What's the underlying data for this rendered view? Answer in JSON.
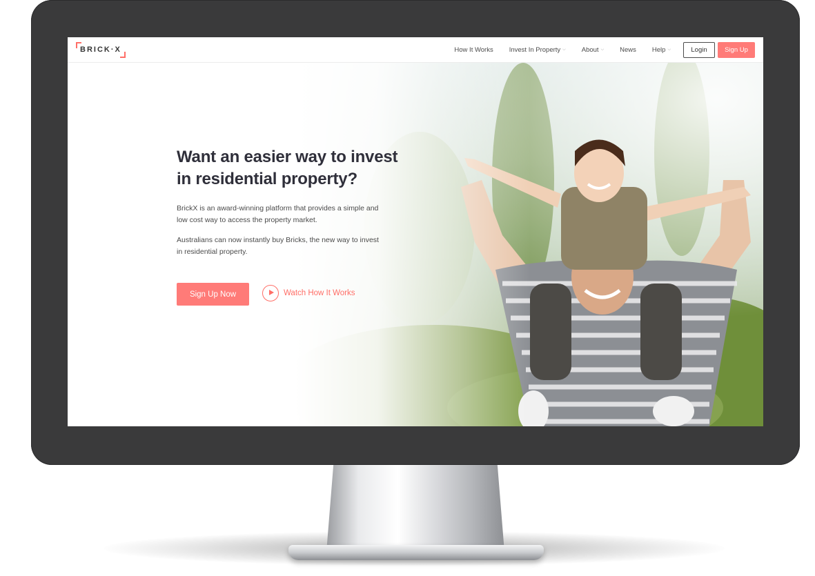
{
  "brand": {
    "logo_text": "BRICK·X",
    "accent_color": "#ff7b78"
  },
  "nav": {
    "links": [
      {
        "label": "How It Works",
        "has_dropdown": false
      },
      {
        "label": "Invest In Property",
        "has_dropdown": true
      },
      {
        "label": "About",
        "has_dropdown": true
      },
      {
        "label": "News",
        "has_dropdown": false
      },
      {
        "label": "Help",
        "has_dropdown": true
      }
    ],
    "login_label": "Login",
    "signup_label": "Sign Up"
  },
  "hero": {
    "headline_line1": "Want an easier way to invest",
    "headline_line2": "in residential property?",
    "paragraph1": "BrickX is an award-winning platform that provides a simple and low cost way to access the property market.",
    "paragraph2": "Australians can now instantly buy Bricks, the new way to invest in residential property.",
    "cta_label": "Sign Up Now",
    "watch_label": "Watch How It Works",
    "photo_description_icon": "father-and-son-photo"
  }
}
